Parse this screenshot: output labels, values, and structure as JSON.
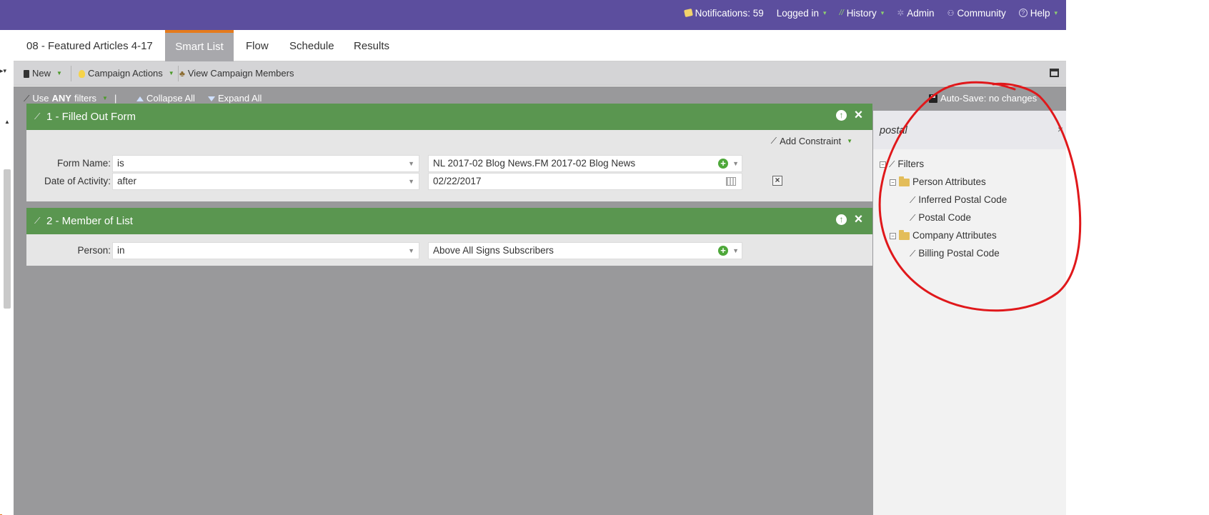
{
  "topnav": {
    "notifications": "Notifications: 59",
    "logged_in": "Logged in",
    "history": "History",
    "admin": "Admin",
    "community": "Community",
    "help": "Help"
  },
  "tabs": [
    {
      "label": "08 - Featured Articles 4-17",
      "active": false
    },
    {
      "label": "Smart List",
      "active": true
    },
    {
      "label": "Flow",
      "active": false
    },
    {
      "label": "Schedule",
      "active": false
    },
    {
      "label": "Results",
      "active": false
    }
  ],
  "toolbar": {
    "new_label": "New",
    "campaign_actions_label": "Campaign Actions",
    "view_members_label": "View Campaign Members"
  },
  "filterbar": {
    "use_prefix": "Use",
    "use_any": "ANY",
    "use_suffix": "filters",
    "divider": "|",
    "collapse_all": "Collapse All",
    "expand_all": "Expand All"
  },
  "filters": [
    {
      "title": "1 - Filled Out Form",
      "add_constraint": "Add Constraint",
      "rows": [
        {
          "label": "Form Name:",
          "operator": "is",
          "value": "NL 2017-02 Blog News.FM 2017-02 Blog News"
        },
        {
          "label": "Date of Activity:",
          "operator": "after",
          "value": "02/22/2017"
        }
      ]
    },
    {
      "title": "2 - Member of List",
      "rows": [
        {
          "label": "Person:",
          "operator": "in",
          "value": "Above All Signs Subscribers"
        }
      ]
    }
  ],
  "palette": {
    "autosave": "Auto-Save: no changes",
    "search_value": "postal",
    "clear": "×",
    "tree": {
      "root": "Filters",
      "person_group": "Person Attributes",
      "person_items": [
        "Inferred Postal Code",
        "Postal Code"
      ],
      "company_group": "Company Attributes",
      "company_items": [
        "Billing Postal Code"
      ]
    }
  },
  "colors": {
    "topbar": "#5c4e9e",
    "accent_tab": "#e57b1c",
    "filter_header": "#5a9650",
    "annotation": "#e0181b"
  }
}
